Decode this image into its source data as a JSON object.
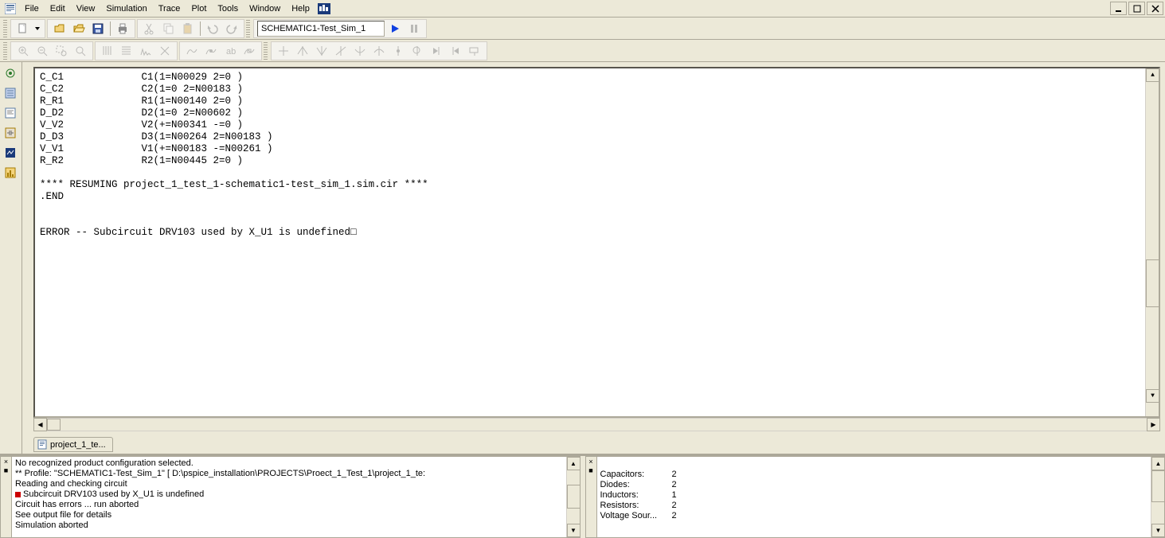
{
  "menu": {
    "file": "File",
    "edit": "Edit",
    "view": "View",
    "simulation": "Simulation",
    "trace": "Trace",
    "plot": "Plot",
    "tools": "Tools",
    "window": "Window",
    "help": "Help"
  },
  "toolbar": {
    "sim_profile": "SCHEMATIC1-Test_Sim_1"
  },
  "doc_tab": "project_1_te...",
  "output_lines": [
    "C_C1             C1(1=N00029 2=0 )",
    "C_C2             C2(1=0 2=N00183 )",
    "R_R1             R1(1=N00140 2=0 )",
    "D_D2             D2(1=0 2=N00602 )",
    "V_V2             V2(+=N00341 -=0 )",
    "D_D3             D3(1=N00264 2=N00183 )",
    "V_V1             V1(+=N00183 -=N00261 )",
    "R_R2             R2(1=N00445 2=0 )",
    "",
    "**** RESUMING project_1_test_1-schematic1-test_sim_1.sim.cir ****",
    ".END",
    "",
    "",
    "ERROR -- Subcircuit DRV103 used by X_U1 is undefined□"
  ],
  "log": [
    {
      "t": "info",
      "text": "No recognized product configuration selected."
    },
    {
      "t": "info",
      "text": "** Profile: \"SCHEMATIC1-Test_Sim_1\"  [ D:\\pspice_installation\\PROJECTS\\Proect_1_Test_1\\project_1_te:"
    },
    {
      "t": "info",
      "text": "Reading and checking circuit"
    },
    {
      "t": "err",
      "text": "Subcircuit DRV103 used by X_U1 is undefined"
    },
    {
      "t": "info",
      "text": "Circuit has errors ... run aborted"
    },
    {
      "t": "info",
      "text": "See output file for details"
    },
    {
      "t": "info",
      "text": "Simulation aborted"
    }
  ],
  "stats": [
    {
      "label": "Capacitors:",
      "value": "2"
    },
    {
      "label": "Diodes:",
      "value": "2"
    },
    {
      "label": "Inductors:",
      "value": "1"
    },
    {
      "label": "Resistors:",
      "value": "2"
    },
    {
      "label": "Voltage Sour...",
      "value": "2"
    }
  ]
}
